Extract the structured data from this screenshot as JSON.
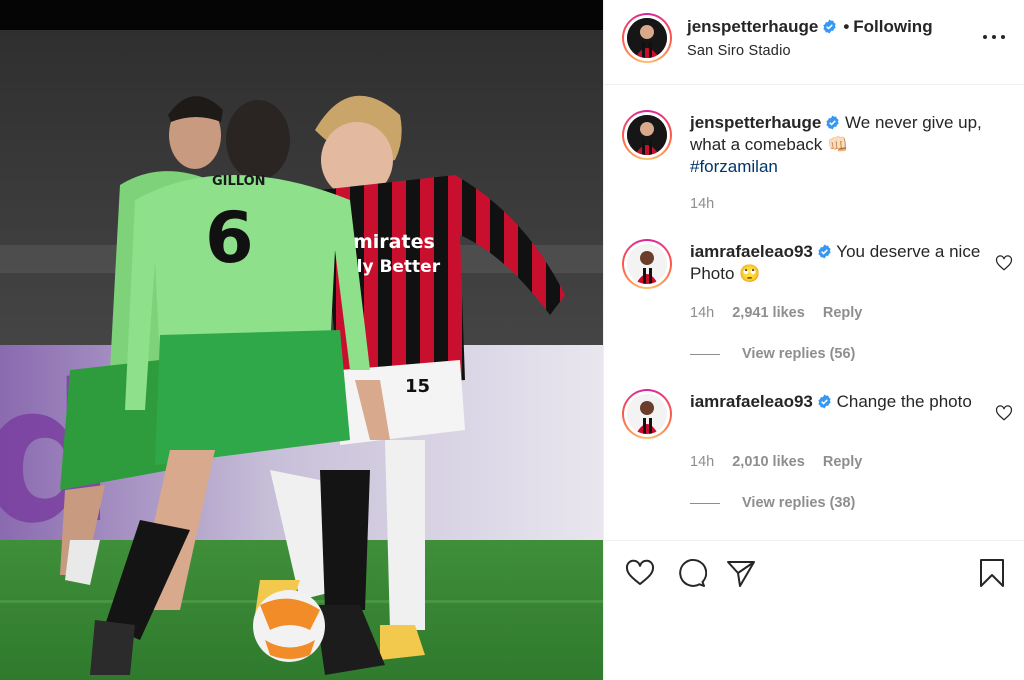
{
  "post": {
    "username": "jenspetterhauge",
    "follow_separator": "•",
    "follow_status": "Following",
    "location": "San Siro Stadio",
    "shirt_number_front": "6",
    "shirt_name_front": "GILLON",
    "shirt_number_runner": "15",
    "sponsor_line1": "Emirates",
    "sponsor_line2": "Fly Better"
  },
  "caption": {
    "username": "jenspetterhauge",
    "text": "We never give up, what a comeback",
    "emoji": "👊🏻",
    "hashtag": "#forzamilan",
    "time": "14h"
  },
  "comments": [
    {
      "username": "iamrafaeleao93",
      "text": "You deserve a nice Photo",
      "emoji": "🙄",
      "time": "14h",
      "likes": "2,941 likes",
      "reply_label": "Reply",
      "view_replies": "View replies (56)"
    },
    {
      "username": "iamrafaeleao93",
      "text": "Change the photo",
      "emoji": "",
      "time": "14h",
      "likes": "2,010 likes",
      "reply_label": "Reply",
      "view_replies": "View replies (38)"
    }
  ],
  "icons": {
    "verified": "verified-badge-icon",
    "more": "more-options-icon",
    "like": "heart-icon",
    "comment": "comment-icon",
    "share": "paper-plane-icon",
    "save": "bookmark-icon"
  },
  "colors": {
    "verified_blue": "#3897f0",
    "hashtag_link": "#00376b",
    "muted_text": "#8e8e8e",
    "milan_red": "#c8102e",
    "celtic_green": "#7ed37a"
  }
}
